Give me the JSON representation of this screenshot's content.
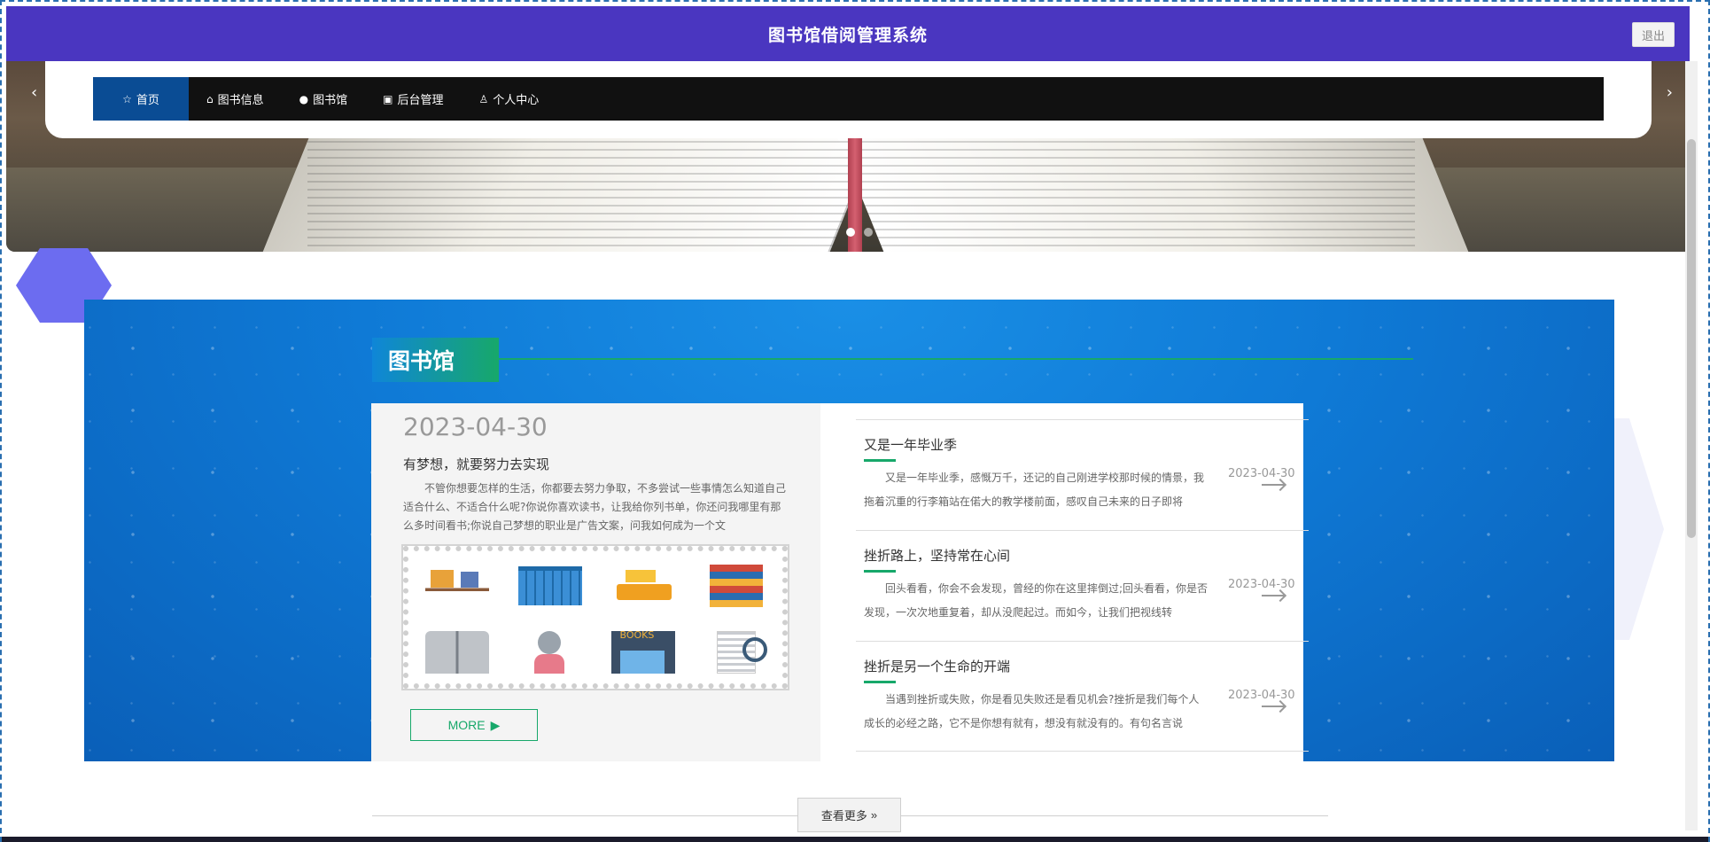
{
  "header": {
    "title": "图书馆借阅管理系统",
    "logout_label": "退出"
  },
  "nav": {
    "items": [
      {
        "label": "首页",
        "icon": "star-icon",
        "glyph": "☆"
      },
      {
        "label": "图书信息",
        "icon": "bag-icon",
        "glyph": "⌂"
      },
      {
        "label": "图书馆",
        "icon": "info-icon",
        "glyph": "●"
      },
      {
        "label": "后台管理",
        "icon": "briefcase-icon",
        "glyph": "▣"
      },
      {
        "label": "个人中心",
        "icon": "user-icon",
        "glyph": "♙"
      }
    ]
  },
  "banner": {
    "prev_glyph": "‹",
    "next_glyph": "›"
  },
  "section": {
    "title": "图书馆",
    "featured": {
      "date": "2023-04-30",
      "title": "有梦想，就要努力去实现",
      "body": "不管你想要怎样的生活，你都要去努力争取，不多尝试一些事情怎么知道自己适合什么、不适合什么呢?你说你喜欢读书，让我给你列书单，你还问我哪里有那么多时间看书;你说自己梦想的职业是广告文案，问我如何成为一个文",
      "more_label": "MORE",
      "more_glyph": "▶"
    },
    "news": [
      {
        "title": "又是一年毕业季",
        "body": "又是一年毕业季，感慨万千，还记的自己刚进学校那时候的情景，我拖着沉重的行李箱站在偌大的教学楼前面，感叹自己未来的日子即将",
        "date": "2023-04-30"
      },
      {
        "title": "挫折路上，坚持常在心间",
        "body": "回头看看，你会不会发现，曾经的你在这里摔倒过;回头看看，你是否发现，一次次地重复着，却从没爬起过。而如今，让我们把视线转",
        "date": "2023-04-30"
      },
      {
        "title": "挫折是另一个生命的开端",
        "body": "当遇到挫折或失败，你是看见失败还是看见机会?挫折是我们每个人成长的必经之路，它不是你想有就有，想没有就没有的。有句名言说",
        "date": "2023-04-30"
      }
    ],
    "view_more_label": "查看更多",
    "view_more_glyph": "»"
  },
  "colors": {
    "header": "#4a36c0",
    "nav_bg": "#111111",
    "nav_active": "#0a4c94",
    "accent_green": "#17a86a",
    "section_blue": "#0f7ad6"
  }
}
